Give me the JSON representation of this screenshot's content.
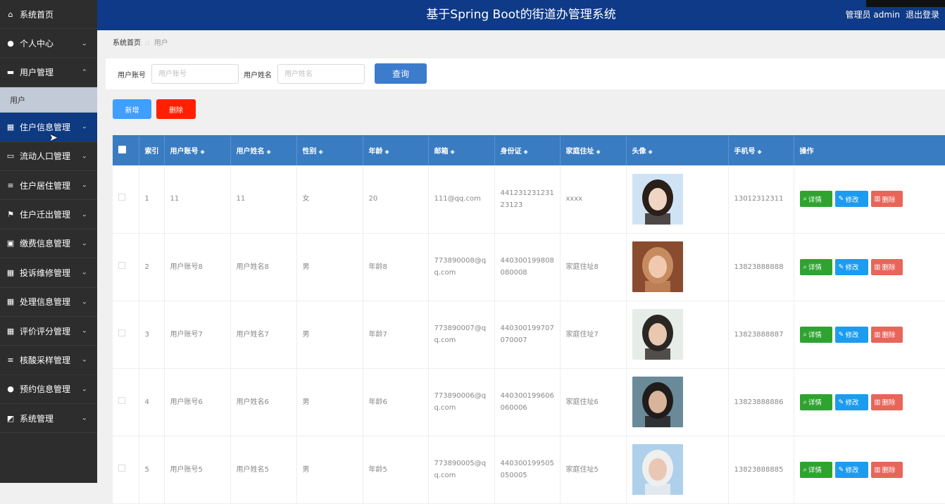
{
  "app": {
    "title": "基于Spring Boot的街道办管理系统",
    "user_label": "管理员 admin",
    "logout_label": "退出登录"
  },
  "sidebar": {
    "items": [
      {
        "label": "系统首页",
        "icon": "home-icon",
        "chevron": ""
      },
      {
        "label": "个人中心",
        "icon": "user-icon",
        "chevron": "⌄"
      },
      {
        "label": "用户管理",
        "icon": "id-card-icon",
        "chevron": "⌃"
      },
      {
        "label": "住户信息管理",
        "icon": "grid-icon",
        "chevron": "⌄"
      },
      {
        "label": "流动人口管理",
        "icon": "chat-icon",
        "chevron": "⌄"
      },
      {
        "label": "住户居住管理",
        "icon": "list-icon",
        "chevron": "⌄"
      },
      {
        "label": "住户迁出管理",
        "icon": "flag-icon",
        "chevron": "⌄"
      },
      {
        "label": "缴费信息管理",
        "icon": "briefcase-icon",
        "chevron": "⌄"
      },
      {
        "label": "投诉维修管理",
        "icon": "grid-icon",
        "chevron": "⌄"
      },
      {
        "label": "处理信息管理",
        "icon": "grid-icon",
        "chevron": "⌄"
      },
      {
        "label": "评价评分管理",
        "icon": "grid-icon",
        "chevron": "⌄"
      },
      {
        "label": "核酸采样管理",
        "icon": "list-icon",
        "chevron": "⌄"
      },
      {
        "label": "预约信息管理",
        "icon": "user-icon",
        "chevron": "⌄"
      },
      {
        "label": "系统管理",
        "icon": "chart-icon",
        "chevron": "⌄"
      }
    ],
    "sub_item": "用户"
  },
  "breadcrumb": {
    "home": "系统首页",
    "separator": "::",
    "current": "用户"
  },
  "search": {
    "account_label": "用户账号",
    "account_placeholder": "用户账号",
    "name_label": "用户姓名",
    "name_placeholder": "用户姓名",
    "query_button": "查询"
  },
  "actions": {
    "add": "新增",
    "delete": "删除"
  },
  "table": {
    "headers": [
      "索引",
      "用户账号",
      "用户姓名",
      "性别",
      "年龄",
      "邮箱",
      "身份证",
      "家庭住址",
      "头像",
      "手机号",
      "操作"
    ],
    "ops": {
      "detail": "详情",
      "edit": "修改",
      "remove": "删除"
    },
    "rows": [
      {
        "index": "1",
        "account": "11",
        "name": "11",
        "gender": "女",
        "age": "20",
        "email": "111@qq.com",
        "id_card": "441231231231 23123",
        "address": "xxxx",
        "phone": "13012312311",
        "avatar": "avatar-photo-1"
      },
      {
        "index": "2",
        "account": "用户账号8",
        "name": "用户姓名8",
        "gender": "男",
        "age": "年龄8",
        "email": "773890008@qq.com",
        "id_card": "440300199808080008",
        "address": "家庭住址8",
        "phone": "13823888888",
        "avatar": "avatar-photo-2"
      },
      {
        "index": "3",
        "account": "用户账号7",
        "name": "用户姓名7",
        "gender": "男",
        "age": "年龄7",
        "email": "773890007@qq.com",
        "id_card": "440300199707070007",
        "address": "家庭住址7",
        "phone": "13823888887",
        "avatar": "avatar-photo-3"
      },
      {
        "index": "4",
        "account": "用户账号6",
        "name": "用户姓名6",
        "gender": "男",
        "age": "年龄6",
        "email": "773890006@qq.com",
        "id_card": "440300199606060006",
        "address": "家庭住址6",
        "phone": "13823888886",
        "avatar": "avatar-photo-4"
      },
      {
        "index": "5",
        "account": "用户账号5",
        "name": "用户姓名5",
        "gender": "男",
        "age": "年龄5",
        "email": "773890005@qq.com",
        "id_card": "440300199505050005",
        "address": "家庭住址5",
        "phone": "13823888885",
        "avatar": "avatar-photo-5"
      }
    ]
  },
  "colors": {
    "sidebar_bg": "#2d2d2d",
    "header_bg": "#0e3a87",
    "table_header": "#3a7cc2",
    "add_btn": "#409eff",
    "delete_btn": "#ff2000"
  }
}
